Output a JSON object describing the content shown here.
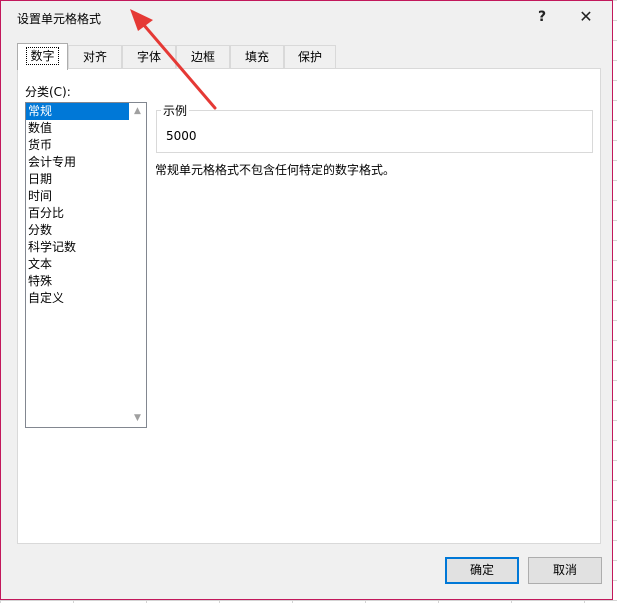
{
  "dialog": {
    "title": "设置单元格格式",
    "help_label": "?",
    "close_label": "✕"
  },
  "tabs": [
    {
      "label": "数字",
      "active": true
    },
    {
      "label": "对齐"
    },
    {
      "label": "字体"
    },
    {
      "label": "边框"
    },
    {
      "label": "填充"
    },
    {
      "label": "保护"
    }
  ],
  "category": {
    "label": "分类(C):",
    "items": [
      "常规",
      "数值",
      "货币",
      "会计专用",
      "日期",
      "时间",
      "百分比",
      "分数",
      "科学记数",
      "文本",
      "特殊",
      "自定义"
    ],
    "selected": "常规"
  },
  "sample": {
    "label": "示例",
    "value": "5000"
  },
  "description": "常规单元格格式不包含任何特定的数字格式。",
  "buttons": {
    "ok": "确定",
    "cancel": "取消"
  },
  "colors": {
    "annotation_arrow": "#e53935",
    "selection": "#0078d7"
  }
}
